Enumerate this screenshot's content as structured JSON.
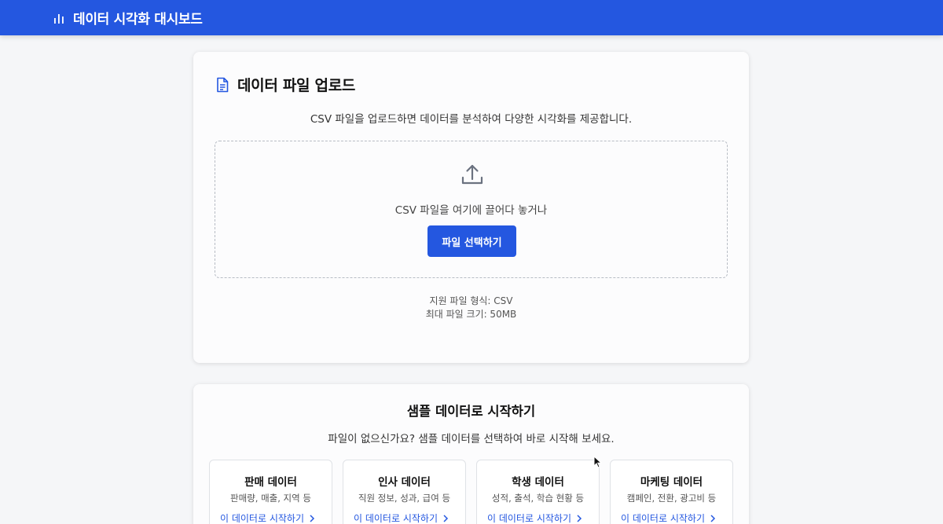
{
  "header": {
    "app_title": "데이터 시각화 대시보드",
    "logo_icon": "bar-chart-icon",
    "bg_color": "#2457e0"
  },
  "upload": {
    "title": "데이터 파일 업로드",
    "title_icon": "document-icon",
    "description": "CSV 파일을 업로드하면 데이터를 분석하여 다양한 시각화를 제공합니다.",
    "dropzone": {
      "icon": "upload-icon",
      "text": "CSV 파일을 여기에 끌어다 놓거나",
      "button_label": "파일 선택하기"
    },
    "supported_format": "지원 파일 형식: CSV",
    "max_size": "최대 파일 크기: 50MB"
  },
  "samples": {
    "title": "샘플 데이터로 시작하기",
    "description": "파일이 없으신가요? 샘플 데이터를 선택하여 바로 시작해 보세요.",
    "items": [
      {
        "name": "판매 데이터",
        "sub": "판매량, 매출, 지역 등",
        "link": "이 데이터로 시작하기"
      },
      {
        "name": "인사 데이터",
        "sub": "직원 정보, 성과, 급여 등",
        "link": "이 데이터로 시작하기"
      },
      {
        "name": "학생 데이터",
        "sub": "성적, 출석, 학습 현황 등",
        "link": "이 데이터로 시작하기"
      },
      {
        "name": "마케팅 데이터",
        "sub": "캠페인, 전환, 광고비 등",
        "link": "이 데이터로 시작하기"
      }
    ]
  },
  "colors": {
    "accent": "#2457e0",
    "page_bg": "#f5f6f8"
  }
}
